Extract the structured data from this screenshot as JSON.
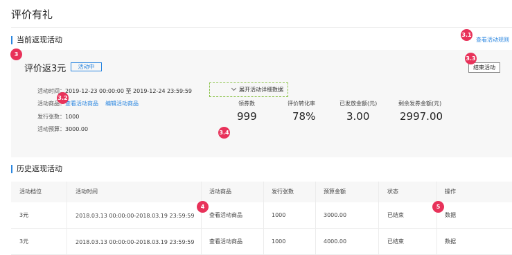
{
  "page": {
    "title": "评价有礼"
  },
  "current_section": {
    "title": "当前返现活动",
    "view_rule_link": "查看活动规则"
  },
  "badges": {
    "b3": "3",
    "b31": "3.1",
    "b32": "3.2",
    "b33": "3.3",
    "b34": "3.4",
    "b4": "4",
    "b5": "5"
  },
  "activity": {
    "title": "评价返3元",
    "status": "活动中",
    "end_button": "结束活动",
    "time_label": "活动时间：",
    "time_value": "2019-12-23 00:00:00 至 2019-12-24 23:59:59",
    "goods_label": "活动商品：",
    "view_goods_link": "查看活动商品",
    "edit_goods_link": "编辑活动商品",
    "issue_label": "发行张数：",
    "issue_value": "1000",
    "budget_label": "活动预算：",
    "budget_value": "3000.00",
    "stats": [
      {
        "label": "领券数",
        "value": "999"
      },
      {
        "label": "评价转化率",
        "value": "78%"
      },
      {
        "label": "已发放金额(元)",
        "value": "3.00"
      },
      {
        "label": "剩余发券金额(元)",
        "value": "2997.00"
      }
    ],
    "expand_link": "展开活动详细数据"
  },
  "history_section": {
    "title": "历史返现活动",
    "columns": [
      "活动档位",
      "活动时间",
      "活动商品",
      "发行张数",
      "预算金额",
      "状态",
      "操作"
    ],
    "rows": [
      {
        "tier": "3元",
        "time": "2018.03.13 00:00:00-2018.03.19 23:59:59",
        "goods": "查看活动商品",
        "issue": "1000",
        "budget": "3000.00",
        "status": "已结束",
        "action": "数据"
      },
      {
        "tier": "3元",
        "time": "2018.03.13 00:00:00-2018.03.19 23:59:59",
        "goods": "查看活动商品",
        "issue": "1000",
        "budget": "4000.00",
        "status": "已结束",
        "action": "数据"
      }
    ]
  },
  "colors": {
    "accent": "#2a86e0",
    "badge": "#e8325a",
    "highlight_border": "#8bc34a"
  }
}
